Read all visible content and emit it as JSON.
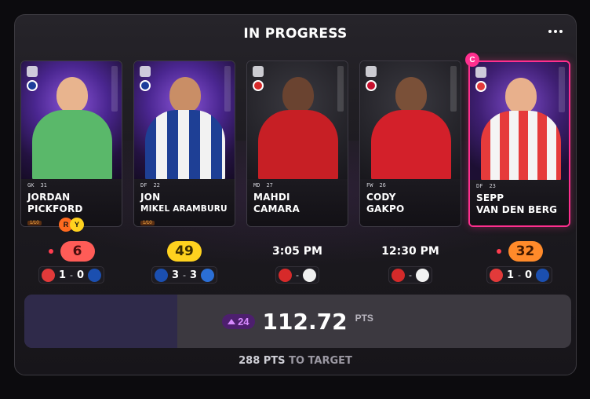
{
  "header": {
    "title": "IN PROGRESS",
    "menu_icon": "more-horizontal-icon"
  },
  "cards": [
    {
      "first": "JORDAN",
      "last": "PICKFORD",
      "stats": [
        "",
        "GK",
        "31"
      ],
      "serial": "1/10",
      "score": "6",
      "score_color": "#ff5c57",
      "score_text": "#4a0e0e",
      "live": true,
      "match": {
        "home": "BRE",
        "away": "EVE",
        "home_score": "1",
        "away_score": "0",
        "home_color": "#e23a3a",
        "away_color": "#1b4fb0"
      }
    },
    {
      "first": "JON",
      "last": "MIKEL ARAMBURU",
      "stats": [
        "",
        "DF",
        "22"
      ],
      "serial": "1/10",
      "score": "49",
      "score_color": "#ffd21f",
      "score_text": "#3a2c00",
      "live": false,
      "match": {
        "home": "RSO",
        "away": "ALA",
        "home_score": "3",
        "away_score": "3",
        "home_color": "#1b4fb0",
        "away_color": "#2b6fd6"
      }
    },
    {
      "first": "MAHDI",
      "last": "CAMARA",
      "stats": [
        "",
        "MD",
        "27"
      ],
      "serial": "",
      "kickoff": "3:05 PM",
      "match": {
        "home": "REN",
        "away": "ANG",
        "home_score": "",
        "away_score": "",
        "home_color": "#d72a2a",
        "away_color": "#f0f0f0"
      }
    },
    {
      "first": "CODY",
      "last": "GAKPO",
      "stats": [
        "",
        "FW",
        "26"
      ],
      "serial": "",
      "kickoff": "12:30 PM",
      "match": {
        "home": "LIV",
        "away": "FUL",
        "home_score": "",
        "away_score": "",
        "home_color": "#d42a2a",
        "away_color": "#f2f2f2"
      }
    },
    {
      "first": "SEPP",
      "last": "VAN DEN BERG",
      "stats": [
        "",
        "DF",
        "23"
      ],
      "serial": "",
      "score": "32",
      "score_color": "#ff8a2a",
      "score_text": "#3f1800",
      "live": true,
      "captain": "C",
      "match": {
        "home": "BRE",
        "away": "EVE",
        "home_score": "1",
        "away_score": "0",
        "home_color": "#e23a3a",
        "away_color": "#1b4fb0"
      }
    }
  ],
  "total": {
    "delta": "24",
    "value": "112.72",
    "unit": "PTS",
    "progress": 0.28
  },
  "target": {
    "amount": "288",
    "unit": "PTS",
    "suffix": "TO TARGET"
  },
  "colors": {
    "accent": "#ff2f8e",
    "purple": "#d78bff"
  }
}
